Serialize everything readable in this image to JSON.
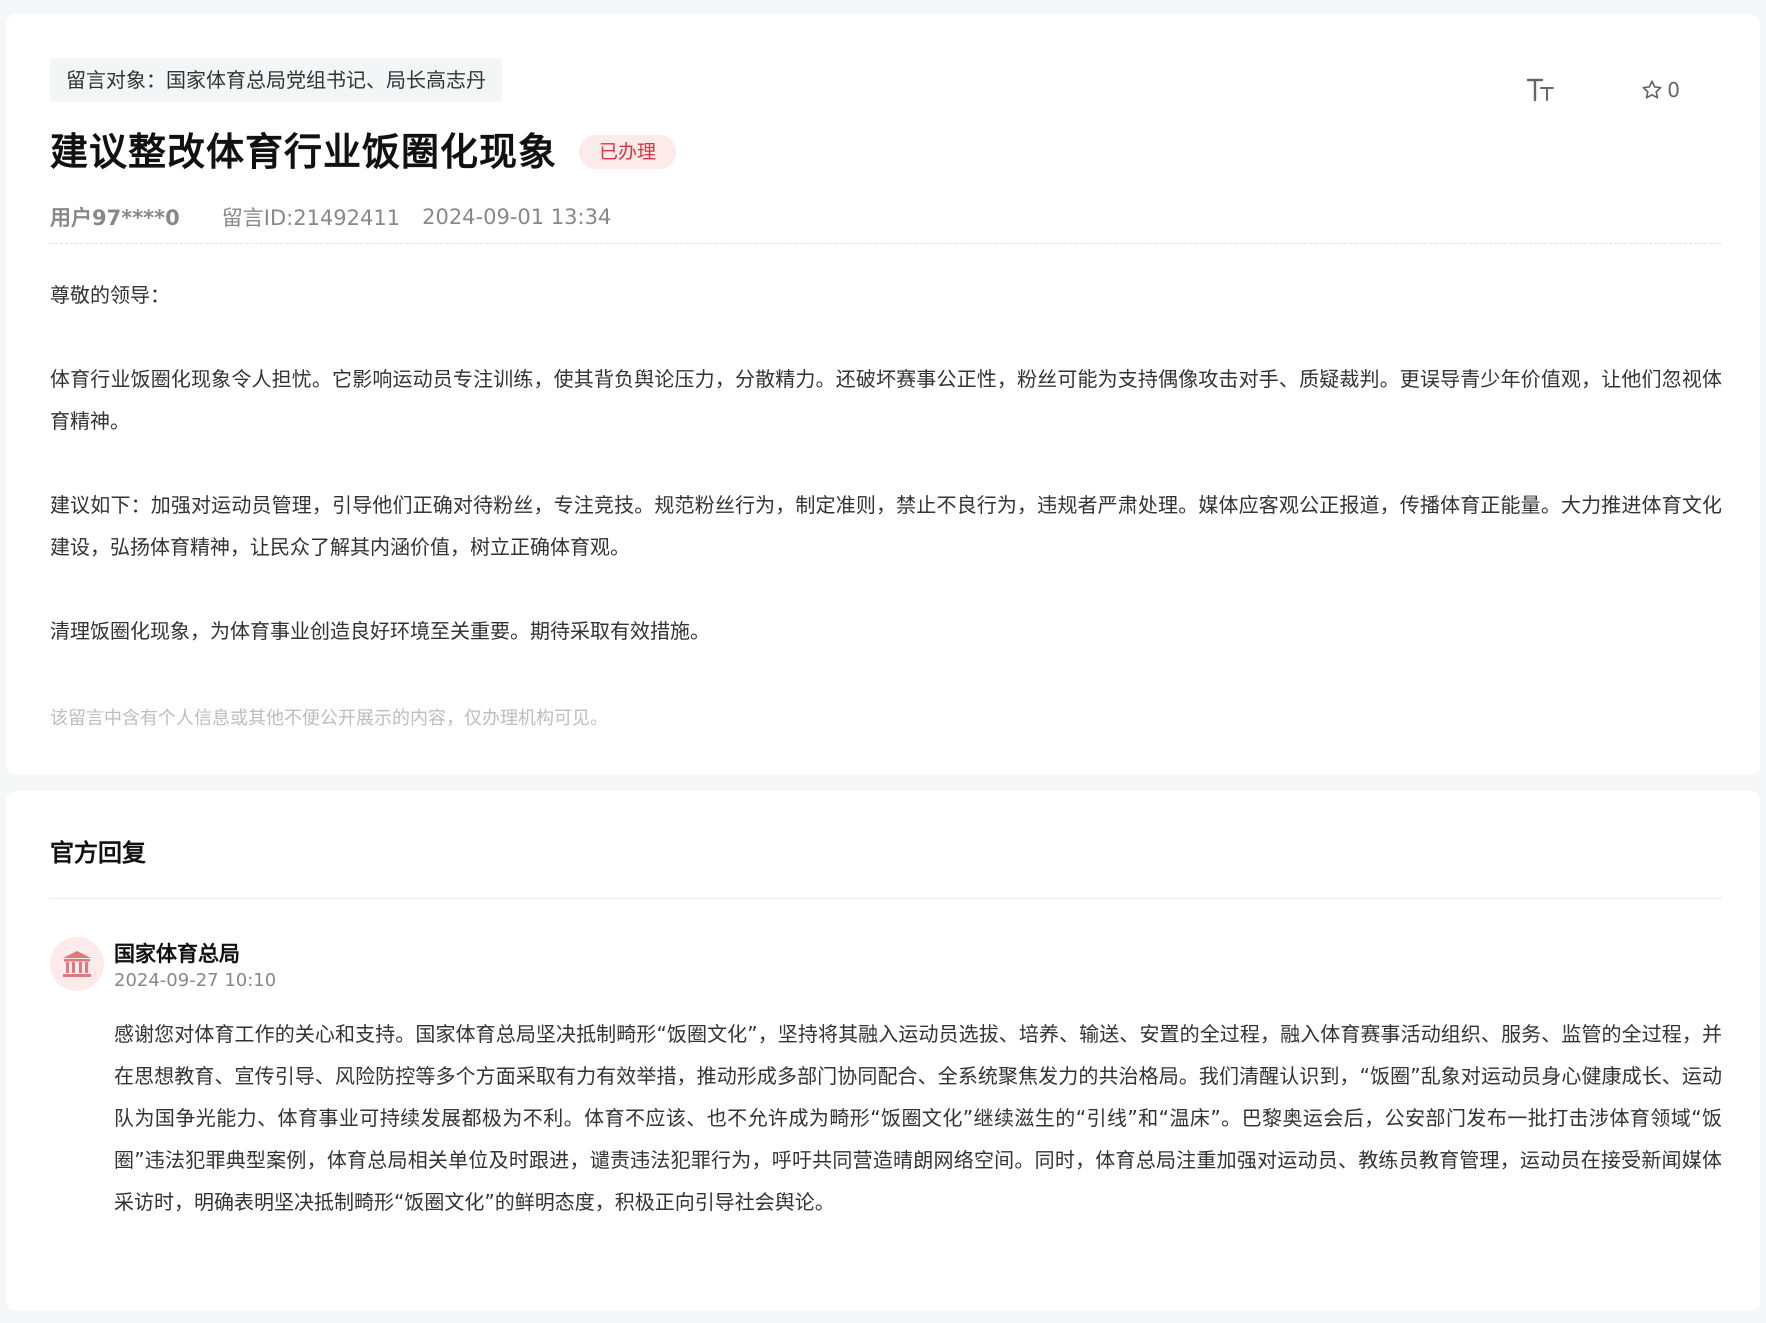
{
  "message": {
    "target_label": "留言对象：",
    "target_value": "国家体育总局党组书记、局长高志丹",
    "title": "建议整改体育行业饭圈化现象",
    "status": "已办理",
    "favorite_count": "0",
    "user": "用户97****0",
    "message_id": "留言ID:21492411",
    "datetime": "2024-09-01 13:34",
    "paragraphs": [
      "尊敬的领导：",
      "体育行业饭圈化现象令人担忧。它影响运动员专注训练，使其背负舆论压力，分散精力。还破坏赛事公正性，粉丝可能为支持偶像攻击对手、质疑裁判。更误导青少年价值观，让他们忽视体育精神。",
      "建议如下：加强对运动员管理，引导他们正确对待粉丝，专注竞技。规范粉丝行为，制定准则，禁止不良行为，违规者严肃处理。媒体应客观公正报道，传播体育正能量。大力推进体育文化建设，弘扬体育精神，让民众了解其内涵价值，树立正确体育观。",
      "清理饭圈化现象，为体育事业创造良好环境至关重要。期待采取有效措施。"
    ],
    "privacy_note": "该留言中含有个人信息或其他不便公开展示的内容，仅办理机构可见。"
  },
  "reply": {
    "heading": "官方回复",
    "org_name": "国家体育总局",
    "time": "2024-09-27 10:10",
    "content": "感谢您对体育工作的关心和支持。国家体育总局坚决抵制畸形“饭圈文化”，坚持将其融入运动员选拔、培养、输送、安置的全过程，融入体育赛事活动组织、服务、监管的全过程，并在思想教育、宣传引导、风险防控等多个方面采取有力有效举措，推动形成多部门协同配合、全系统聚焦发力的共治格局。我们清醒认识到，“饭圈”乱象对运动员身心健康成长、运动队为国争光能力、体育事业可持续发展都极为不利。体育不应该、也不允许成为畸形“饭圈文化”继续滋生的“引线”和“温床”。巴黎奥运会后，公安部门发布一批打击涉体育领域“饭圈”违法犯罪典型案例，体育总局相关单位及时跟进，谴责违法犯罪行为，呼吁共同营造晴朗网络空间。同时，体育总局注重加强对运动员、教练员教育管理，运动员在接受新闻媒体采访时，明确表明坚决抵制畸形“饭圈文化”的鲜明态度，积极正向引导社会舆论。"
  },
  "icons": {
    "font_size": "font-size-icon",
    "favorite": "star-outline-icon",
    "org_avatar": "government-building-icon"
  },
  "colors": {
    "status_text": "#d6363f",
    "status_bg": "#fdeaea",
    "avatar_bg": "#fdebec",
    "avatar_icon": "#e0797c"
  }
}
